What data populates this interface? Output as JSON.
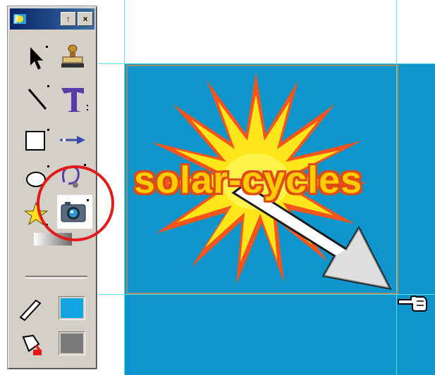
{
  "toolbox": {
    "titlebar": {
      "minimize_label": "↑",
      "close_label": "×"
    },
    "tools": [
      {
        "id": "pointer",
        "icon": "arrow-pointer-icon"
      },
      {
        "id": "stamp",
        "icon": "stamp-icon"
      },
      {
        "id": "line",
        "icon": "line-icon"
      },
      {
        "id": "text",
        "icon": "text-T-icon"
      },
      {
        "id": "rectangle",
        "icon": "rectangle-icon"
      },
      {
        "id": "hotspot",
        "icon": "hotspot-arrow-icon"
      },
      {
        "id": "ellipse",
        "icon": "ellipse-icon"
      },
      {
        "id": "lasso",
        "icon": "lasso-icon"
      },
      {
        "id": "star",
        "icon": "star-icon"
      },
      {
        "id": "camera",
        "icon": "camera-icon",
        "selected": true
      },
      {
        "id": "gradient",
        "icon": "gradient-icon"
      }
    ],
    "stroke_color": "#12a6e0",
    "fill_color": "#7a7a7a"
  },
  "canvas": {
    "background_color": "#0e95cc",
    "logo_text": "solar-cycles",
    "sun_color": "#ffe61a",
    "ray_color": "#f5551a"
  },
  "annotation": {
    "circle_color": "#e21a1a"
  }
}
